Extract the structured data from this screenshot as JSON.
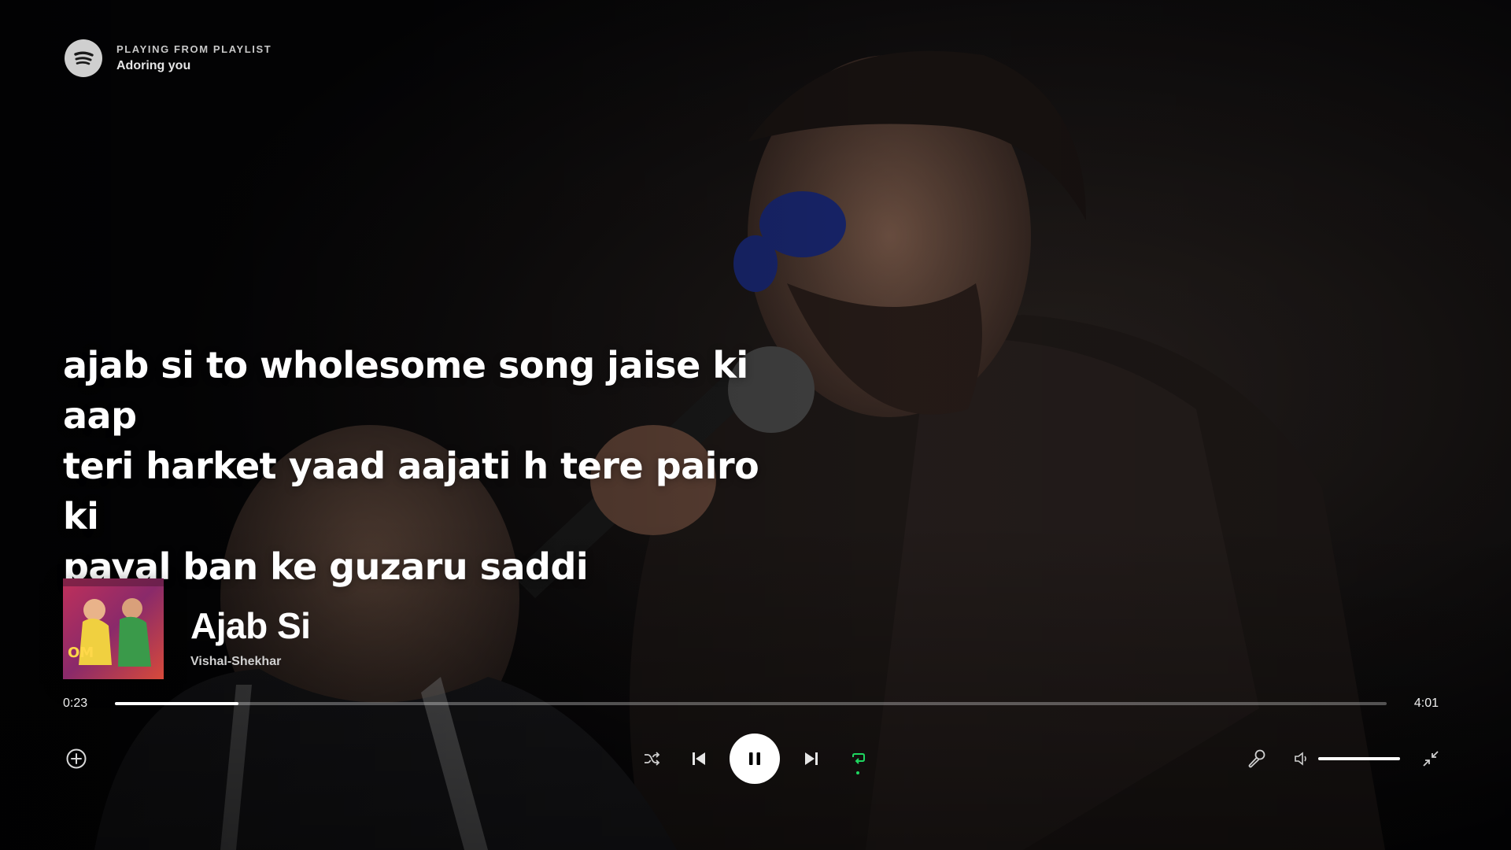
{
  "header": {
    "context_label": "PLAYING FROM PLAYLIST",
    "context_name": "Adoring you"
  },
  "lyrics": {
    "lines": [
      "ajab si to wholesome song jaise ki aap",
      "teri harket yaad aajati h tere pairo ki",
      "payal ban ke guzaru saddi"
    ]
  },
  "track": {
    "title": "Ajab Si",
    "artist": "Vishal-Shekhar"
  },
  "progress": {
    "elapsed": "0:23",
    "duration": "4:01",
    "fraction": 0.097
  },
  "controls": {
    "shuffle_icon": "shuffle-icon",
    "previous_icon": "skip-previous-icon",
    "play_state_icon": "pause-icon",
    "next_icon": "skip-next-icon",
    "repeat_icon": "repeat-icon",
    "repeat_active": true,
    "add_icon": "add-circle-icon",
    "lyrics_icon": "microphone-icon",
    "volume_icon": "speaker-icon",
    "minimize_icon": "minimize-icon",
    "volume_level": 1.0
  },
  "colors": {
    "accent": "#1ed760",
    "text": "#ffffff",
    "background": "#0a0a0c"
  }
}
